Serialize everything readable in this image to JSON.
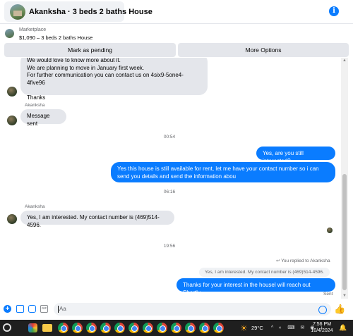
{
  "header": {
    "title": "Akanksha · 3 beds 2 baths House",
    "info_icon": "info-icon"
  },
  "listing": {
    "source": "Marketplace",
    "title": "$1,090 – 3 beds 2 baths House"
  },
  "actions": {
    "mark_pending": "Mark as pending",
    "more_options": "More Options"
  },
  "messages": {
    "first_bubble_lines": [
      "We would love to know more about it.",
      "We are planning to move in January first week.",
      "For further communication you can contact us on 4six9-5one4-4five96",
      "",
      "Thanks"
    ],
    "sender_name_1": "Akanksha",
    "message_sent": "Message sent",
    "time_1": "00:54",
    "out_1": "Yes, are you still interested?",
    "out_2": "Yes this house is still available for rent, let me have your contact number so i can send you details and send the information abou",
    "time_2": "06:16",
    "sender_name_2": "Akanksha",
    "in_reply": "Yes, I am interested. My contact number is (469)514-4596.",
    "time_3": "19:56",
    "replied_note": "You replied to Akanksha",
    "quoted": "Yes, I am interested. My contact number is (469)514-4596.",
    "out_3": "Thanks for your interest in the housel will reach out Shortly",
    "sent_status": "Sent"
  },
  "composer": {
    "placeholder": "Aa"
  },
  "taskbar": {
    "temperature": "29°C",
    "time": "7:56 PM",
    "date": "10/4/2024",
    "tray_icons": "^ ◐ ⌨ ✉ ◉ ♪"
  },
  "colors": {
    "accent": "#0a7cff",
    "incoming_bubble": "#e4e6eb",
    "taskbar": "#1f1f1f"
  }
}
